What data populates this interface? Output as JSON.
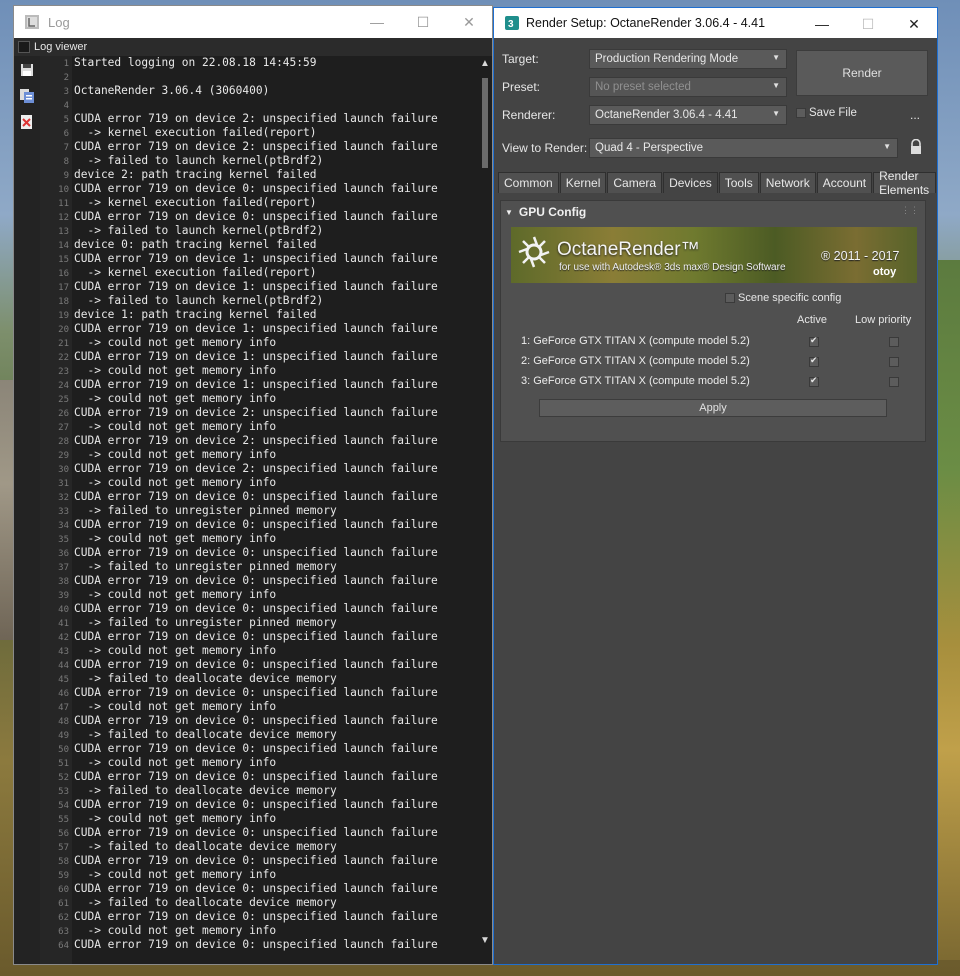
{
  "log_window": {
    "title": "Log",
    "subtitle": "Log viewer",
    "line_numbers": [
      "1",
      "2",
      "3",
      "4",
      "5",
      "6",
      "7",
      "8",
      "9",
      "10",
      "11",
      "12",
      "13",
      "14",
      "15",
      "16",
      "17",
      "18",
      "19",
      "20",
      "21",
      "22",
      "23",
      "24",
      "25",
      "26",
      "27",
      "28",
      "29",
      "30",
      "31",
      "32",
      "33",
      "34",
      "35",
      "36",
      "37",
      "38",
      "39",
      "40",
      "41",
      "42",
      "43",
      "44",
      "45",
      "46",
      "47",
      "48",
      "49",
      "50",
      "51",
      "52",
      "53",
      "54",
      "55",
      "56",
      "57",
      "58",
      "59",
      "60",
      "61",
      "62",
      "63",
      "64"
    ],
    "lines": [
      "Started logging on 22.08.18 14:45:59",
      "",
      "OctaneRender 3.06.4 (3060400)",
      "",
      "CUDA error 719 on device 2: unspecified launch failure",
      "  -> kernel execution failed(report)",
      "CUDA error 719 on device 2: unspecified launch failure",
      "  -> failed to launch kernel(ptBrdf2)",
      "device 2: path tracing kernel failed",
      "CUDA error 719 on device 0: unspecified launch failure",
      "  -> kernel execution failed(report)",
      "CUDA error 719 on device 0: unspecified launch failure",
      "  -> failed to launch kernel(ptBrdf2)",
      "device 0: path tracing kernel failed",
      "CUDA error 719 on device 1: unspecified launch failure",
      "  -> kernel execution failed(report)",
      "CUDA error 719 on device 1: unspecified launch failure",
      "  -> failed to launch kernel(ptBrdf2)",
      "device 1: path tracing kernel failed",
      "CUDA error 719 on device 1: unspecified launch failure",
      "  -> could not get memory info",
      "CUDA error 719 on device 1: unspecified launch failure",
      "  -> could not get memory info",
      "CUDA error 719 on device 1: unspecified launch failure",
      "  -> could not get memory info",
      "CUDA error 719 on device 2: unspecified launch failure",
      "  -> could not get memory info",
      "CUDA error 719 on device 2: unspecified launch failure",
      "  -> could not get memory info",
      "CUDA error 719 on device 2: unspecified launch failure",
      "  -> could not get memory info",
      "CUDA error 719 on device 0: unspecified launch failure",
      "  -> failed to unregister pinned memory",
      "CUDA error 719 on device 0: unspecified launch failure",
      "  -> could not get memory info",
      "CUDA error 719 on device 0: unspecified launch failure",
      "  -> failed to unregister pinned memory",
      "CUDA error 719 on device 0: unspecified launch failure",
      "  -> could not get memory info",
      "CUDA error 719 on device 0: unspecified launch failure",
      "  -> failed to unregister pinned memory",
      "CUDA error 719 on device 0: unspecified launch failure",
      "  -> could not get memory info",
      "CUDA error 719 on device 0: unspecified launch failure",
      "  -> failed to deallocate device memory",
      "CUDA error 719 on device 0: unspecified launch failure",
      "  -> could not get memory info",
      "CUDA error 719 on device 0: unspecified launch failure",
      "  -> failed to deallocate device memory",
      "CUDA error 719 on device 0: unspecified launch failure",
      "  -> could not get memory info",
      "CUDA error 719 on device 0: unspecified launch failure",
      "  -> failed to deallocate device memory",
      "CUDA error 719 on device 0: unspecified launch failure",
      "  -> could not get memory info",
      "CUDA error 719 on device 0: unspecified launch failure",
      "  -> failed to deallocate device memory",
      "CUDA error 719 on device 0: unspecified launch failure",
      "  -> could not get memory info",
      "CUDA error 719 on device 0: unspecified launch failure",
      "  -> failed to deallocate device memory",
      "CUDA error 719 on device 0: unspecified launch failure",
      "  -> could not get memory info",
      "CUDA error 719 on device 0: unspecified launch failure"
    ]
  },
  "render_setup": {
    "title": "Render Setup: OctaneRender 3.06.4 - 4.41",
    "target_label": "Target:",
    "target_value": "Production Rendering Mode",
    "preset_label": "Preset:",
    "preset_value": "No preset selected",
    "renderer_label": "Renderer:",
    "renderer_value": "OctaneRender 3.06.4 - 4.41",
    "save_file_label": "Save File",
    "more_label": "...",
    "view_label": "View to Render:",
    "view_value": "Quad 4 - Perspective",
    "render_button": "Render",
    "tabs": [
      "Common",
      "Kernel",
      "Camera",
      "Devices",
      "Tools",
      "Network",
      "Account",
      "Render Elements"
    ],
    "active_tab": "Devices",
    "rollout_title": "GPU Config",
    "banner": {
      "brand": "OctaneRender™",
      "sub": "for use with Autodesk® 3ds max® Design Software",
      "years": "® 2011 - 2017",
      "company": "otoy"
    },
    "scene_specific_label": "Scene specific config",
    "col_active": "Active",
    "col_low": "Low priority",
    "gpus": [
      {
        "label": "1:  GeForce GTX TITAN X (compute model 5.2)",
        "active": true,
        "low": false
      },
      {
        "label": "2:  GeForce GTX TITAN X (compute model 5.2)",
        "active": true,
        "low": false
      },
      {
        "label": "3:  GeForce GTX TITAN X (compute model 5.2)",
        "active": true,
        "low": false
      }
    ],
    "apply_label": "Apply"
  }
}
